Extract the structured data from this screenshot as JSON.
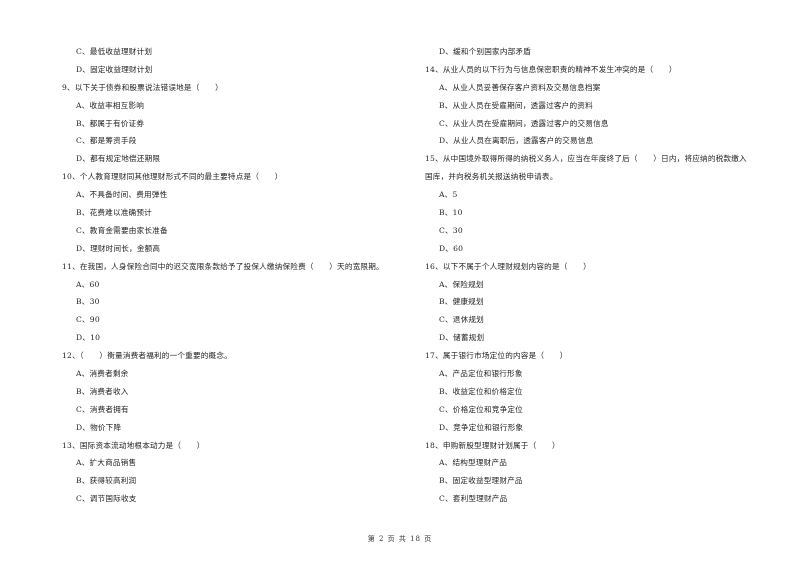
{
  "left_column": [
    {
      "type": "option",
      "text": "C、最低收益理财计划"
    },
    {
      "type": "option",
      "text": "D、固定收益理财计划"
    },
    {
      "type": "question",
      "text": "9、以下关于债券和股票说法错误地是（　　）"
    },
    {
      "type": "option",
      "text": "A、收益率相互影响"
    },
    {
      "type": "option",
      "text": "B、都属于有价证券"
    },
    {
      "type": "option",
      "text": "C、都是筹资手段"
    },
    {
      "type": "option",
      "text": "D、都有规定地偿还期限"
    },
    {
      "type": "question",
      "text": "10、个人教育理财同其他理财形式不同的最主要特点是（　　）"
    },
    {
      "type": "option",
      "text": "A、不具备时间、费用弹性"
    },
    {
      "type": "option",
      "text": "B、花费难以准确预计"
    },
    {
      "type": "option",
      "text": "C、教育金需要由家长准备"
    },
    {
      "type": "option",
      "text": "D、理财时间长，金额高"
    },
    {
      "type": "question",
      "text": "11、在我国，人身保险合同中的迟交宽限条款给予了投保人缴纳保险费（　　）天的宽限期。"
    },
    {
      "type": "option",
      "text": "A、60"
    },
    {
      "type": "option",
      "text": "B、30"
    },
    {
      "type": "option",
      "text": "C、90"
    },
    {
      "type": "option",
      "text": "D、10"
    },
    {
      "type": "question",
      "text": "12、（　　）衡量消费者福利的一个重要的概念。"
    },
    {
      "type": "option",
      "text": "A、消费者剩余"
    },
    {
      "type": "option",
      "text": "B、消费者收入"
    },
    {
      "type": "option",
      "text": "C、消费者拥有"
    },
    {
      "type": "option",
      "text": "D、物价下降"
    },
    {
      "type": "question",
      "text": "13、国际资本流动地根本动力是（　　）"
    },
    {
      "type": "option",
      "text": "A、扩大商品销售"
    },
    {
      "type": "option",
      "text": "B、获得较高利润"
    },
    {
      "type": "option",
      "text": "C、调节国际收支"
    }
  ],
  "right_column": [
    {
      "type": "option",
      "text": "D、缓和个别国家内部矛盾"
    },
    {
      "type": "question",
      "text": "14、从业人员的以下行为与信息保密职责的精神不发生冲突的是（　　）"
    },
    {
      "type": "option",
      "text": "A、从业人员妥善保存客户资料及交易信息档案"
    },
    {
      "type": "option",
      "text": "B、从业人员在受雇期间，透露过客户的资料"
    },
    {
      "type": "option",
      "text": "C、从业人员在受雇期间，透露过客户的交易信息"
    },
    {
      "type": "option",
      "text": "D、从业人员在离职后，透露客户的交易信息"
    },
    {
      "type": "question",
      "text": "15、从中国境外取得所得的纳税义务人，应当在年度终了后（　　）日内，将应纳的税款缴入"
    },
    {
      "type": "question",
      "text": "国库，并向税务机关报送纳税申请表。"
    },
    {
      "type": "option",
      "text": "A、5"
    },
    {
      "type": "option",
      "text": "B、10"
    },
    {
      "type": "option",
      "text": "C、30"
    },
    {
      "type": "option",
      "text": "D、60"
    },
    {
      "type": "question",
      "text": "16、以下不属于个人理财规划内容的是（　　）"
    },
    {
      "type": "option",
      "text": "A、保险规划"
    },
    {
      "type": "option",
      "text": "B、健康规划"
    },
    {
      "type": "option",
      "text": "C、退休规划"
    },
    {
      "type": "option",
      "text": "D、储蓄规划"
    },
    {
      "type": "question",
      "text": "17、属于银行市场定位的内容是（　　）"
    },
    {
      "type": "option",
      "text": "A、产品定位和银行形象"
    },
    {
      "type": "option",
      "text": "B、收益定位和价格定位"
    },
    {
      "type": "option",
      "text": "C、价格定位和竞争定位"
    },
    {
      "type": "option",
      "text": "D、竞争定位和银行形象"
    },
    {
      "type": "question",
      "text": "18、申购新股型理财计划属于（　　）"
    },
    {
      "type": "option",
      "text": "A、结构型理财产品"
    },
    {
      "type": "option",
      "text": "B、固定收益型理财产品"
    },
    {
      "type": "option",
      "text": "C、套利型理财产品"
    }
  ],
  "footer": {
    "text": "第 2 页 共 18 页"
  }
}
